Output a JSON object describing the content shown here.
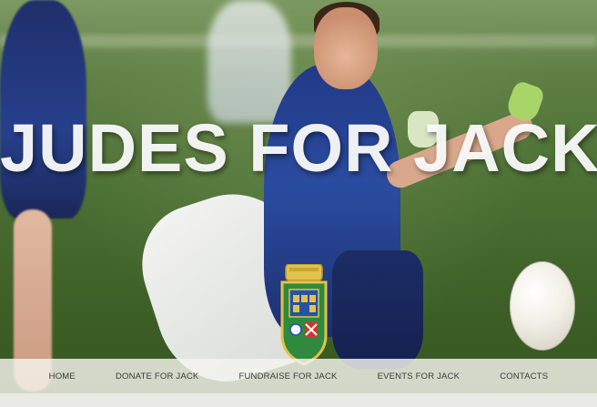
{
  "hero": {
    "title": "JUDES FOR JACK",
    "crest_icon": "gaa-club-crest-icon"
  },
  "nav": {
    "items": [
      {
        "label": "HOME"
      },
      {
        "label": "DONATE FOR JACK"
      },
      {
        "label": "FUNDRAISE FOR JACK"
      },
      {
        "label": "EVENTS FOR JACK"
      },
      {
        "label": "CONTACTS"
      }
    ]
  },
  "colors": {
    "title": "#ffffff",
    "nav_background": "#f5f4ee",
    "nav_text": "#3a3a3a",
    "jersey_navy": "#213a86",
    "grass": "#4f7236"
  }
}
